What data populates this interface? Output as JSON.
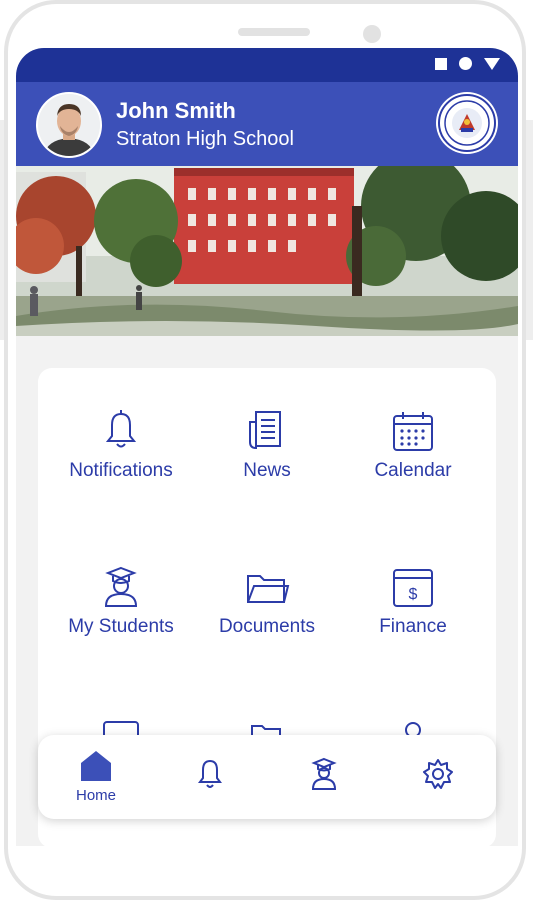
{
  "profile": {
    "name": "John Smith",
    "school": "Straton High School"
  },
  "menu": {
    "items": [
      {
        "label": "Notifications",
        "icon": "bell-icon"
      },
      {
        "label": "News",
        "icon": "news-icon"
      },
      {
        "label": "Calendar",
        "icon": "calendar-icon"
      },
      {
        "label": "My Students",
        "icon": "student-icon"
      },
      {
        "label": "Documents",
        "icon": "folder-icon"
      },
      {
        "label": "Finance",
        "icon": "finance-icon"
      }
    ]
  },
  "bottom_nav": {
    "items": [
      {
        "label": "Home",
        "icon": "home-icon",
        "active": true
      },
      {
        "label": "",
        "icon": "bell-icon",
        "active": false
      },
      {
        "label": "",
        "icon": "student-icon",
        "active": false
      },
      {
        "label": "",
        "icon": "gear-icon",
        "active": false
      }
    ]
  },
  "colors": {
    "status_bar": "#1e3296",
    "header": "#3c50b8",
    "accent": "#2c3ca8",
    "content_bg": "#f2f2f2"
  }
}
